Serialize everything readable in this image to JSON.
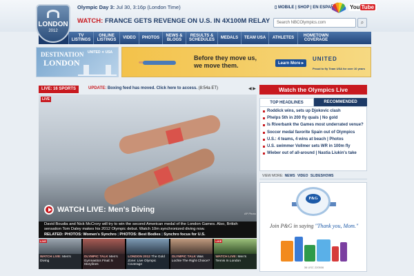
{
  "header": {
    "day_line_bold": "Olympic Day 3:",
    "day_line_rest": "Jul 30, 3:16p (London Time)",
    "logo_text": "LONDON",
    "logo_year": "2012",
    "top_links": [
      "MOBILE",
      "SHOP",
      "EN ESPAÑOL"
    ],
    "youtube": "You",
    "youtube_tube": "Tube",
    "watch_label": "WATCH:",
    "watch_headline": "FRANCE GETS REVENGE ON U.S. IN 4X100M RELAY",
    "search_placeholder": "Search NBCOlympics.com",
    "search_icon_glyph": "⌕"
  },
  "nav": [
    "SELECT ▾ A SPORT",
    "TV LISTINGS",
    "ONLINE LISTINGS",
    "VIDEO",
    "PHOTOS",
    "NEWS & BLOGS",
    "RESULTS & SCHEDULES",
    "MEDALS",
    "TEAM USA",
    "ATHLETES",
    "HOMETOWN COVERAGE"
  ],
  "promo_left": {
    "line1": "DESTINATION",
    "line2": "LONDON",
    "sponsor": "UNITED ✦ USA"
  },
  "promo_right": {
    "text1": "Before they move us,",
    "text2": "we move them.",
    "button": "Learn More ▸",
    "brand": "UNITED",
    "brand_sub": "Proud to fly Team USA for over 10 years"
  },
  "live_bar": {
    "live_label": "LIVE: 16 SPORTS",
    "update_label": "UPDATE:",
    "update_text": "Boxing feed has moved. Click here to access.",
    "update_time": "(8:54a ET)",
    "arrows": "◀ ▶"
  },
  "hero": {
    "live_tag": "LIVE",
    "title": "WATCH LIVE: Men's Diving",
    "credit": "AP Photo",
    "caption": "David Boudia and Nick McCrory will try to win the second American medal of the London Games. Also, British sensation Tom Daley makes his 2012 Olympic debut. Watch 10m synchronized diving now.",
    "related_label": "RELATED:",
    "related_links": [
      "PHOTOS: Women's Synchro",
      "PHOTOS: Best Bodies",
      "Synchro focus for U.S."
    ]
  },
  "thumbs": [
    {
      "tag": "LIVE",
      "label_pre": "WATCH LIVE:",
      "label": "Men's Diving"
    },
    {
      "tag": "",
      "label_pre": "OLYMPIC TALK",
      "label": "Men's Gymnastics Final: 5 Storylines"
    },
    {
      "tag": "",
      "label_pre": "LONDON 2012",
      "label": "The Gold Zone: Live Olympic Coverage"
    },
    {
      "tag": "",
      "label_pre": "OLYMPIC TALK",
      "label": "Was Lochte The Right Choice?"
    },
    {
      "tag": "LIVE",
      "label_pre": "WATCH LIVE:",
      "label": "Men's Tennis In London"
    }
  ],
  "sidebar": {
    "watch_button": "Watch the Olympics Live",
    "tabs": [
      "TOP HEADLINES",
      "RECOMMENDED"
    ],
    "headlines": [
      "Roddick wins, sets up Djokovic clash",
      "Phelps 5th in 200 fly quals | No gold",
      "Is Riverbank the Games most underrated venue?",
      "Soccer medal favorite Spain out of Olympics",
      "U.S.: 4 teams, 4 wins at beach | Photos",
      "U.S. swimmer Vollmer sets WR in 100m fly",
      "Wieber out of all-around | Nastia Liukin's take"
    ],
    "view_more_label": "VIEW MORE:",
    "view_more_links": [
      "NEWS",
      "VIDEO",
      "SLIDESHOWS"
    ]
  },
  "ad": {
    "logo": "P&G",
    "text_pre": "Join P&G in saying",
    "text_quote": "\"Thank you, Mom.\"",
    "code": "36 USC 220506"
  },
  "colors": {
    "accent_red": "#c8191f",
    "nav_blue": "#22457a",
    "link_blue": "#1d3a66"
  }
}
